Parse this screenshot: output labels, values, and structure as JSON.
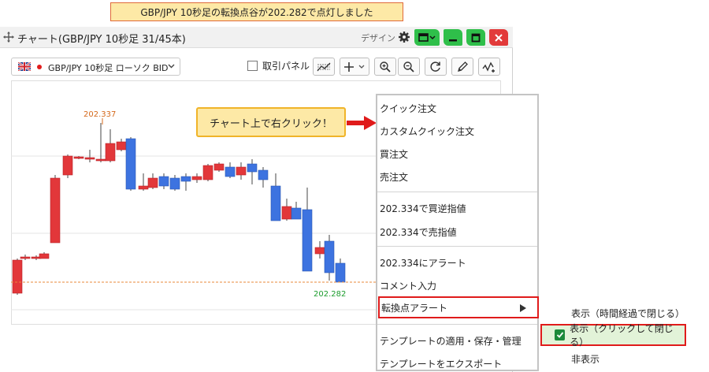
{
  "banner": {
    "text": "GBP/JPY 10秒足の転換点谷が202.282で点灯しました"
  },
  "window": {
    "title": "チャート(GBP/JPY 10秒足 31/45本)",
    "design_label": "デザイン"
  },
  "toolbar": {
    "symbol": "GBP/JPY 10秒足 ローソク BID",
    "order_panel_label": "取引パネル",
    "order_panel_checked": false
  },
  "chart": {
    "high_label": "202.337",
    "low_label": "202.282",
    "up_color": "#e2373a",
    "down_color": "#3d73e0",
    "high_label_color": "#d5691b",
    "low_label_color": "#1d9c2e"
  },
  "callout": {
    "text": "チャート上で右クリック！"
  },
  "context_menu": {
    "items": [
      "クイック注文",
      "カスタムクイック注文",
      "買注文",
      "売注文",
      "202.334で買逆指値",
      "202.334で売指値",
      "202.334にアラート",
      "コメント入力",
      "転換点アラート",
      "テンプレートの適用・保存・管理",
      "テンプレートをエクスポート"
    ]
  },
  "submenu": {
    "items": [
      "表示（時間経過で閉じる）",
      "表示（クリックして閉じる）",
      "非表示"
    ],
    "checked_index": 1
  }
}
